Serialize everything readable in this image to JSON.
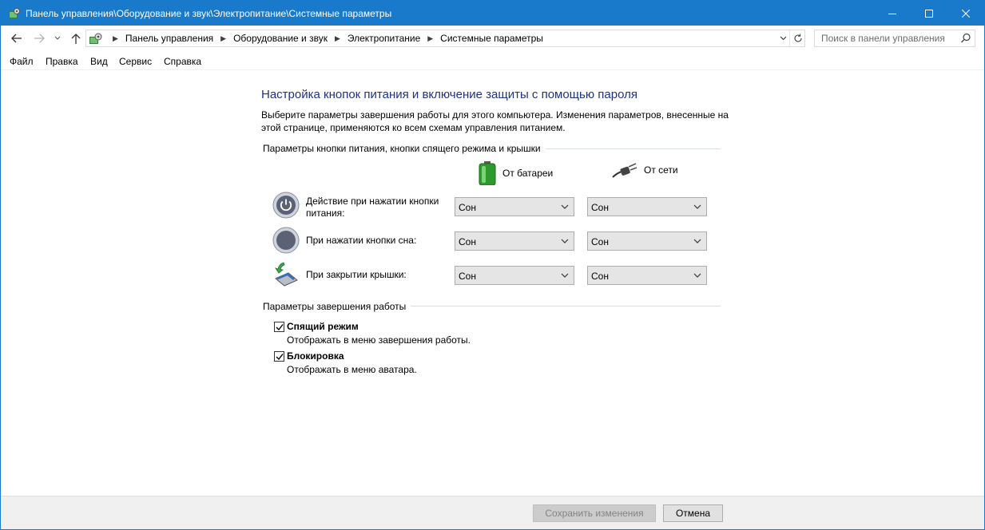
{
  "window": {
    "title": "Панель управления\\Оборудование и звук\\Электропитание\\Системные параметры"
  },
  "nav": {
    "breadcrumbs": [
      "Панель управления",
      "Оборудование и звук",
      "Электропитание",
      "Системные параметры"
    ],
    "search_placeholder": "Поиск в панели управления"
  },
  "menu": [
    "Файл",
    "Правка",
    "Вид",
    "Сервис",
    "Справка"
  ],
  "page": {
    "title": "Настройка кнопок питания и включение защиты с помощью пароля",
    "description": "Выберите параметры завершения работы для этого компьютера. Изменения параметров, внесенные на этой странице, применяются ко всем схемам управления питанием."
  },
  "power_section": {
    "heading": "Параметры кнопки питания, кнопки спящего режима и крышки",
    "col_battery": "От батареи",
    "col_ac": "От сети",
    "rows": [
      {
        "label": "Действие при нажатии кнопки питания:",
        "battery": "Сон",
        "ac": "Сон",
        "icon": "power-button-icon"
      },
      {
        "label": "При нажатии кнопки сна:",
        "battery": "Сон",
        "ac": "Сон",
        "icon": "sleep-button-icon"
      },
      {
        "label": "При закрытии крышки:",
        "battery": "Сон",
        "ac": "Сон",
        "icon": "laptop-lid-icon"
      }
    ]
  },
  "shutdown_section": {
    "heading": "Параметры завершения работы",
    "items": [
      {
        "title": "Спящий режим",
        "desc": "Отображать в меню завершения работы.",
        "checked": true
      },
      {
        "title": "Блокировка",
        "desc": "Отображать в меню аватара.",
        "checked": true
      }
    ]
  },
  "footer": {
    "save_label": "Сохранить изменения",
    "cancel_label": "Отмена"
  },
  "colors": {
    "titlebar": "#1979ca",
    "page_title": "#1e3287"
  }
}
